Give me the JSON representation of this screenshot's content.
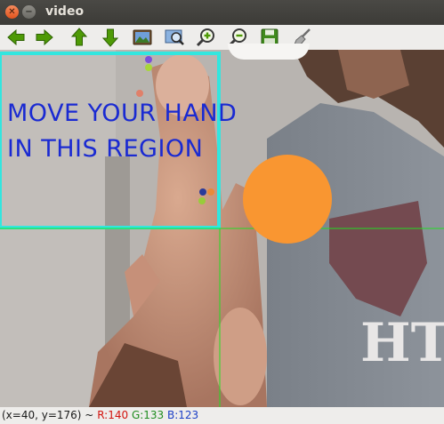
{
  "window": {
    "title": "video"
  },
  "toolbar": {
    "buttons": [
      {
        "name": "pan-left-button",
        "icon": "arrow-left-icon"
      },
      {
        "name": "pan-right-button",
        "icon": "arrow-right-icon"
      },
      {
        "name": "pan-up-button",
        "icon": "arrow-up-icon"
      },
      {
        "name": "pan-down-button",
        "icon": "arrow-down-icon"
      },
      {
        "name": "zoom-original-button",
        "icon": "picture-icon"
      },
      {
        "name": "zoom-fit-button",
        "icon": "zoom-window-icon"
      },
      {
        "name": "zoom-in-button",
        "icon": "zoom-in-icon"
      },
      {
        "name": "zoom-out-button",
        "icon": "zoom-out-icon"
      },
      {
        "name": "save-button",
        "icon": "floppy-disk-icon"
      },
      {
        "name": "properties-button",
        "icon": "brush-icon"
      }
    ]
  },
  "overlay": {
    "line1": "MOVE YOUR HAND",
    "line2": "IN THIS REGION",
    "region_color": "#32e6df",
    "text_color": "#1a2ad2",
    "circle_color": "#f99631",
    "crosshair_color": "#22dd22"
  },
  "status": {
    "coords": "(x=40, y=176) ~",
    "r": "R:140",
    "g": "G:133",
    "b": "B:123"
  }
}
